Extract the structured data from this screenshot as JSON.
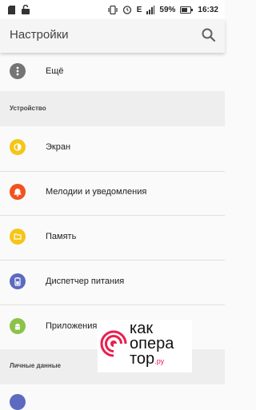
{
  "status_bar": {
    "battery_percent": "59%",
    "time": "16:32",
    "signal_label": "E"
  },
  "app_bar": {
    "title": "Настройки",
    "search_icon": "search-icon"
  },
  "rows": [
    {
      "label": "Ещё",
      "icon": "more-vert-icon",
      "color": "#757575"
    },
    {
      "label": "Экран",
      "icon": "brightness-icon",
      "color": "#f5c518"
    },
    {
      "label": "Мелодии и уведомления",
      "icon": "bell-icon",
      "color": "#f4511e"
    },
    {
      "label": "Память",
      "icon": "storage-icon",
      "color": "#f5c518"
    },
    {
      "label": "Диспетчер питания",
      "icon": "battery-icon",
      "color": "#5c6bc0"
    },
    {
      "label": "Приложения",
      "icon": "android-icon",
      "color": "#8bc34a"
    }
  ],
  "sections": {
    "device": "Устройство",
    "personal": "Личные данные"
  },
  "watermark": {
    "line1": "как",
    "line2": "опера",
    "line3": "тор",
    "suffix": ".ру",
    "accent": "#e91e4f"
  }
}
